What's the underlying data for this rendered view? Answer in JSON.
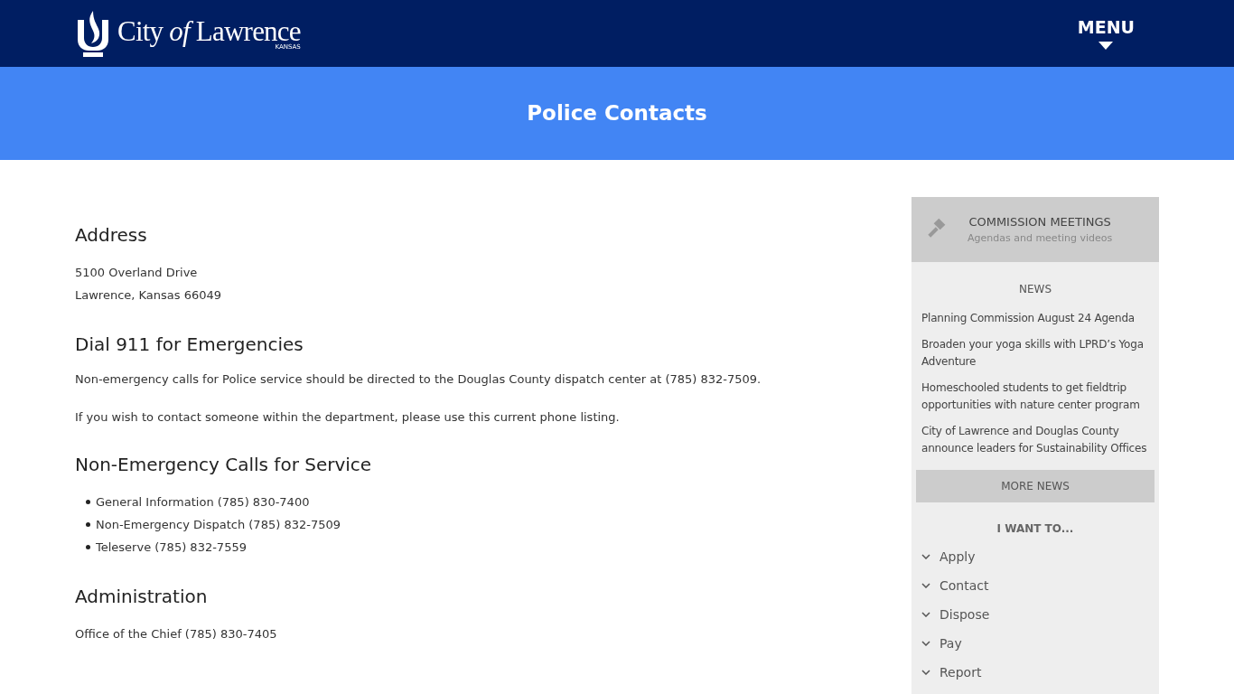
{
  "header": {
    "logo_name": "City *of* Lawrence",
    "logo_state": "KANSAS",
    "menu_label": "MENU"
  },
  "banner": {
    "title": "Police Contacts"
  },
  "sections": [
    {
      "heading": "Address",
      "blocks": [
        {
          "kind": "lines",
          "lines": [
            "5100 Overland Drive",
            "Lawrence, Kansas 66049"
          ]
        }
      ]
    },
    {
      "heading": "Dial 911 for Emergencies",
      "blocks": [
        {
          "kind": "paragraph",
          "text": "Non-emergency calls for Police service should be directed to the Douglas County dispatch center at (785) 832-7509."
        },
        {
          "kind": "paragraph",
          "text": "If you wish to contact someone within the department, please use this current phone listing."
        }
      ]
    },
    {
      "heading": "Non-Emergency Calls for Service",
      "blocks": [
        {
          "kind": "list",
          "items": [
            "General Information (785) 830-7400",
            "Non-Emergency Dispatch (785) 832-7509",
            "Teleserve (785) 832-7559"
          ]
        }
      ]
    },
    {
      "heading": "Administration",
      "blocks": [
        {
          "kind": "lines",
          "lines": [
            "Office of the Chief (785) 830-7405"
          ]
        }
      ]
    }
  ],
  "sidebar": {
    "feature": {
      "title": "COMMISSION MEETINGS",
      "subtitle": "Agendas and meeting videos"
    },
    "news_heading": "NEWS",
    "news": [
      "Planning Commission August 24 Agenda",
      "Broaden your yoga skills with LPRD’s Yoga Adventure",
      "Homeschooled students to get fieldtrip opportunities with nature center program",
      "City of Lawrence and Douglas County announce leaders for Sustainability Offices"
    ],
    "more_news": "MORE NEWS",
    "want_heading": "I WANT TO...",
    "want_items": [
      {
        "label": "Apply",
        "expanded": false
      },
      {
        "label": "Contact",
        "expanded": false
      },
      {
        "label": "Dispose",
        "expanded": false
      },
      {
        "label": "Pay",
        "expanded": false
      },
      {
        "label": "Report",
        "expanded": false
      }
    ]
  }
}
